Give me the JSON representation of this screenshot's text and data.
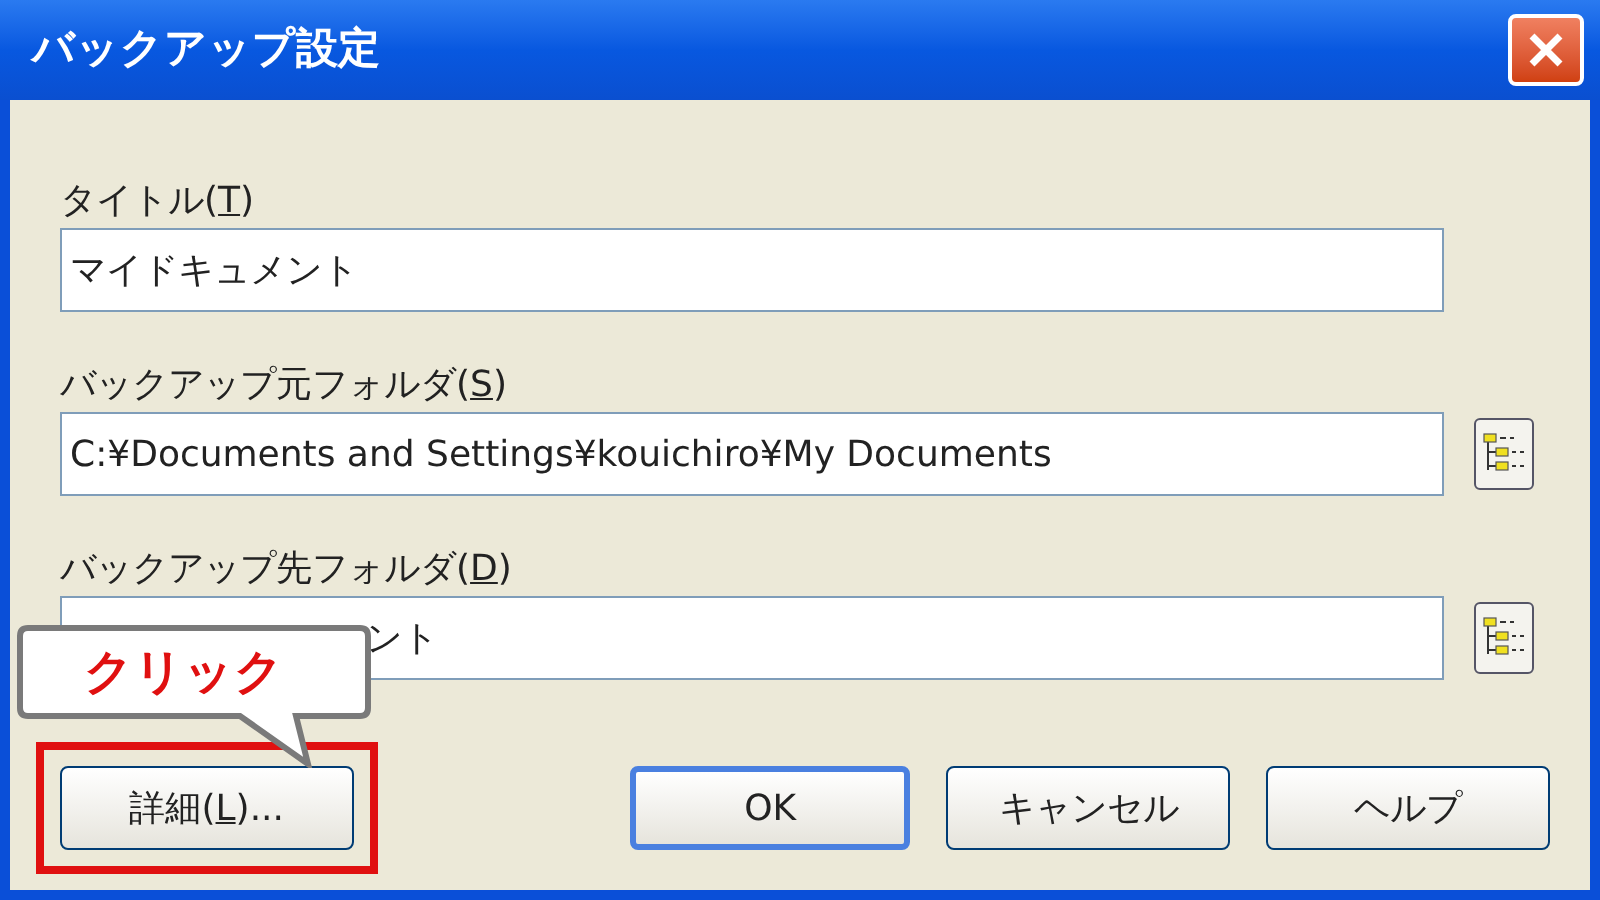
{
  "window": {
    "title": "バックアップ設定"
  },
  "fields": [
    {
      "label": {
        "before": "タイトル(",
        "key": "T",
        "after": ")"
      },
      "value": "マイドキュメント",
      "kind": "plain",
      "browse": false
    },
    {
      "label": {
        "before": "バックアップ元フォルダ(",
        "key": "S",
        "after": ")"
      },
      "value": "C:¥Documents and Settings¥kouichiro¥My Documents",
      "kind": "plain",
      "browse": true
    },
    {
      "label": {
        "before": "バックアップ先フォルダ(",
        "key": "D",
        "after": ")"
      },
      "value": "ント",
      "kind": "covered",
      "browse": true
    }
  ],
  "buttons": [
    {
      "label": {
        "before": "詳細(",
        "key": "L",
        "after": ")..."
      },
      "default": false,
      "highlighted": true
    },
    {
      "label": {
        "before": "OK"
      },
      "default": true,
      "highlighted": false
    },
    {
      "label": {
        "before": "キャンセル"
      },
      "default": false,
      "highlighted": false
    },
    {
      "label": {
        "before": "ヘルプ"
      },
      "default": false,
      "highlighted": false
    }
  ],
  "callout": {
    "text": "クリック"
  }
}
